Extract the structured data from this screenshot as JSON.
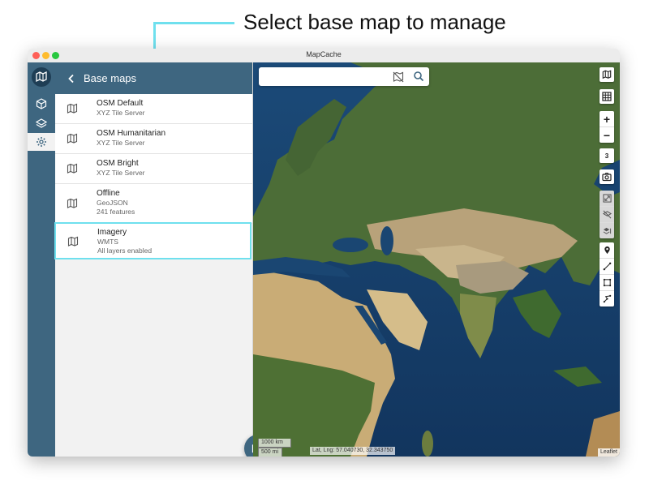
{
  "callout": {
    "text": "Select base map to manage"
  },
  "window": {
    "title": "MapCache"
  },
  "panel": {
    "title": "Base maps",
    "items": [
      {
        "name": "OSM Default",
        "sub1": "XYZ Tile Server",
        "sub2": ""
      },
      {
        "name": "OSM Humanitarian",
        "sub1": "XYZ Tile Server",
        "sub2": ""
      },
      {
        "name": "OSM Bright",
        "sub1": "XYZ Tile Server",
        "sub2": ""
      },
      {
        "name": "Offline",
        "sub1": "GeoJSON",
        "sub2": "241 features"
      }
    ],
    "selected": {
      "name": "Imagery",
      "sub1": "WMTS",
      "sub2": "All layers enabled"
    }
  },
  "map": {
    "search_placeholder": "",
    "zoom_in": "+",
    "zoom_out": "−",
    "zoom_level": "3",
    "scale_km": "1000 km",
    "scale_mi": "500 mi",
    "coords": "Lat, Lng: 57.040730, 32.343750",
    "attribution": "Leaflet"
  },
  "colors": {
    "accent": "#3e6680",
    "highlight": "#6fe0ee",
    "ocean": "#173e67"
  }
}
